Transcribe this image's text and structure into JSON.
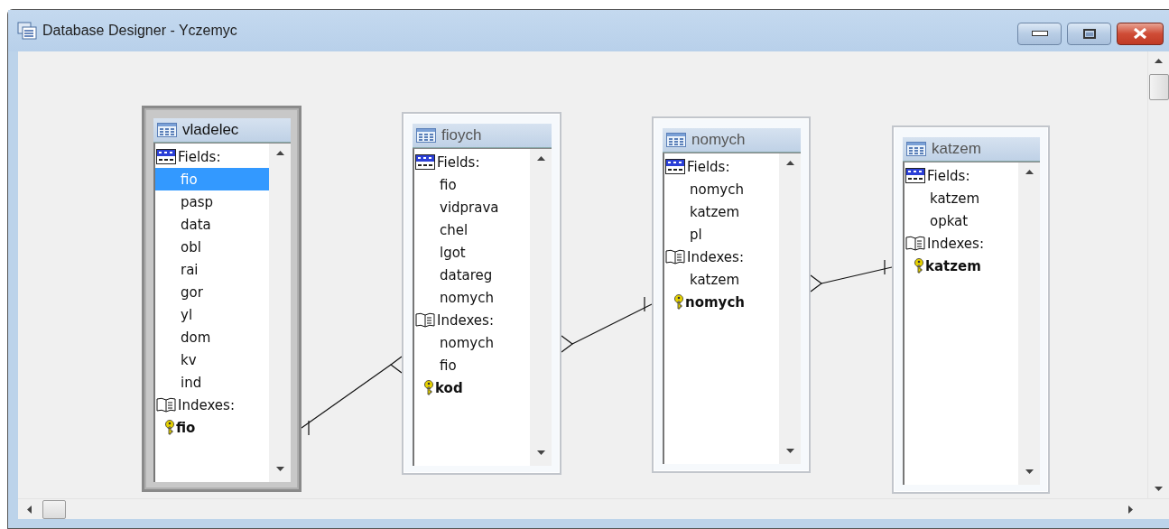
{
  "window": {
    "title": "Database Designer - Yczemyc"
  },
  "tables": [
    {
      "name": "vladelec",
      "active": true,
      "sections": [
        {
          "kind": "fields",
          "label": "Fields:",
          "items": [
            {
              "name": "fio",
              "selected": true,
              "primary": false
            },
            {
              "name": "pasp",
              "selected": false,
              "primary": false
            },
            {
              "name": "data",
              "selected": false,
              "primary": false
            },
            {
              "name": "obl",
              "selected": false,
              "primary": false
            },
            {
              "name": "rai",
              "selected": false,
              "primary": false
            },
            {
              "name": "gor",
              "selected": false,
              "primary": false
            },
            {
              "name": "yl",
              "selected": false,
              "primary": false
            },
            {
              "name": "dom",
              "selected": false,
              "primary": false
            },
            {
              "name": "kv",
              "selected": false,
              "primary": false
            },
            {
              "name": "ind",
              "selected": false,
              "primary": false
            }
          ]
        },
        {
          "kind": "indexes",
          "label": "Indexes:",
          "items": [
            {
              "name": "fio",
              "selected": false,
              "primary": true
            }
          ]
        }
      ]
    },
    {
      "name": "fioych",
      "active": false,
      "sections": [
        {
          "kind": "fields",
          "label": "Fields:",
          "items": [
            {
              "name": "fio",
              "selected": false,
              "primary": false
            },
            {
              "name": "vidprava",
              "selected": false,
              "primary": false
            },
            {
              "name": "chel",
              "selected": false,
              "primary": false
            },
            {
              "name": "lgot",
              "selected": false,
              "primary": false
            },
            {
              "name": "datareg",
              "selected": false,
              "primary": false
            },
            {
              "name": "nomych",
              "selected": false,
              "primary": false
            }
          ]
        },
        {
          "kind": "indexes",
          "label": "Indexes:",
          "items": [
            {
              "name": "nomych",
              "selected": false,
              "primary": false
            },
            {
              "name": "fio",
              "selected": false,
              "primary": false
            },
            {
              "name": "kod",
              "selected": false,
              "primary": true
            }
          ]
        }
      ]
    },
    {
      "name": "nomych",
      "active": false,
      "sections": [
        {
          "kind": "fields",
          "label": "Fields:",
          "items": [
            {
              "name": "nomych",
              "selected": false,
              "primary": false
            },
            {
              "name": "katzem",
              "selected": false,
              "primary": false
            },
            {
              "name": "pl",
              "selected": false,
              "primary": false
            }
          ]
        },
        {
          "kind": "indexes",
          "label": "Indexes:",
          "items": [
            {
              "name": "katzem",
              "selected": false,
              "primary": false
            },
            {
              "name": "nomych",
              "selected": false,
              "primary": true
            }
          ]
        }
      ]
    },
    {
      "name": "katzem",
      "active": false,
      "sections": [
        {
          "kind": "fields",
          "label": "Fields:",
          "items": [
            {
              "name": "katzem",
              "selected": false,
              "primary": false
            },
            {
              "name": "opkat",
              "selected": false,
              "primary": false
            }
          ]
        },
        {
          "kind": "indexes",
          "label": "Indexes:",
          "items": [
            {
              "name": "katzem",
              "selected": false,
              "primary": true
            }
          ]
        }
      ]
    }
  ]
}
